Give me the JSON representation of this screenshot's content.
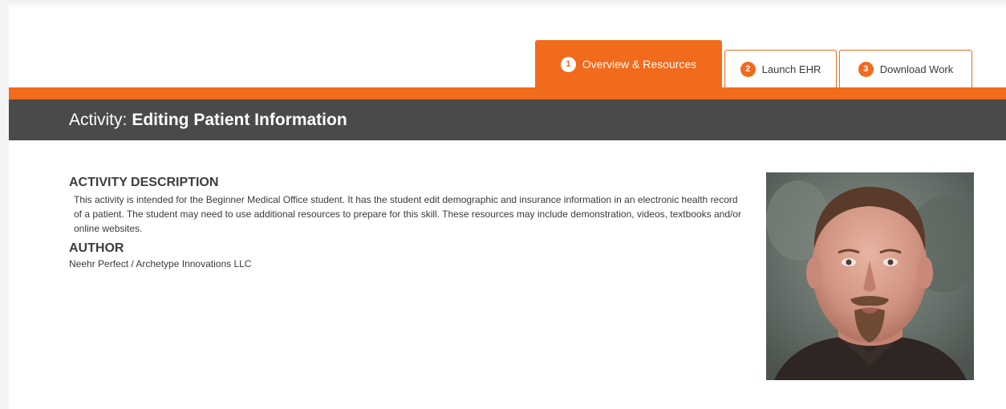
{
  "tabs": [
    {
      "number": "1",
      "label": "Overview & Resources",
      "active": true
    },
    {
      "number": "2",
      "label": "Launch EHR",
      "active": false
    },
    {
      "number": "3",
      "label": "Download Work",
      "active": false
    }
  ],
  "activity": {
    "prefix": "Activity:",
    "name": "Editing Patient Information"
  },
  "description": {
    "heading": "ACTIVITY DESCRIPTION",
    "text": "This activity is intended for the Beginner Medical Office student. It has the student edit demographic and insurance information in an electronic health record of a patient. The student may need to use additional resources to prepare for this skill. These resources may include demonstration, videos, textbooks and/or online websites."
  },
  "author": {
    "heading": "AUTHOR",
    "name": "Neehr Perfect / Archetype Innovations LLC"
  },
  "colors": {
    "accent": "#f26a1b",
    "title_bar": "#4a4a4a"
  },
  "icons": {
    "author_photo": "author-photo"
  }
}
